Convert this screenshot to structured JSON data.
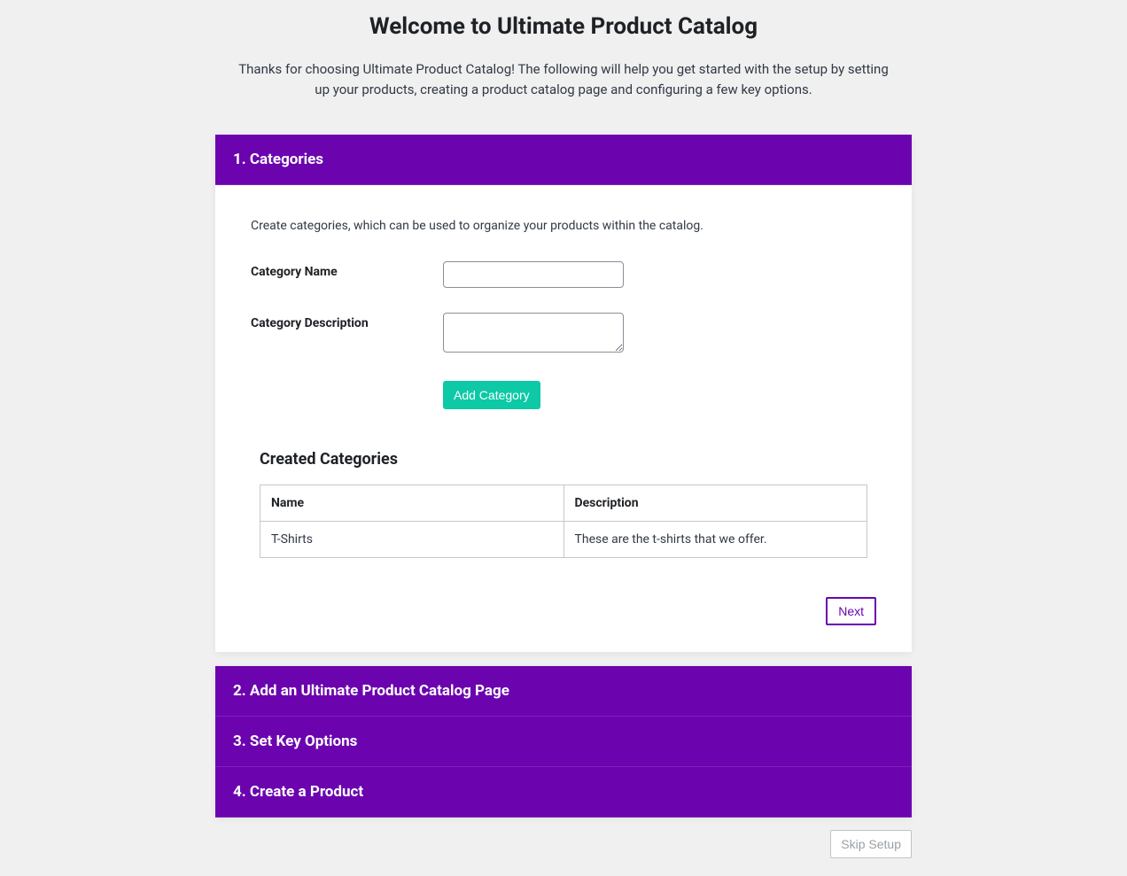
{
  "header": {
    "title": "Welcome to Ultimate Product Catalog",
    "subtitle": "Thanks for choosing Ultimate Product Catalog! The following will help you get started with the setup by setting up your products, creating a product catalog page and configuring a few key options."
  },
  "steps": {
    "s1": {
      "title": "1. Categories"
    },
    "s2": {
      "title": "2. Add an Ultimate Product Catalog Page"
    },
    "s3": {
      "title": "3. Set Key Options"
    },
    "s4": {
      "title": "4. Create a Product"
    }
  },
  "categories_step": {
    "description": "Create categories, which can be used to organize your products within the catalog.",
    "name_label": "Category Name",
    "desc_label": "Category Description",
    "add_button": "Add Category",
    "created_title": "Created Categories",
    "table": {
      "col_name": "Name",
      "col_desc": "Description",
      "row0": {
        "name": "T-Shirts",
        "desc": "These are the t-shirts that we offer."
      }
    },
    "next_button": "Next"
  },
  "skip_button": "Skip Setup"
}
